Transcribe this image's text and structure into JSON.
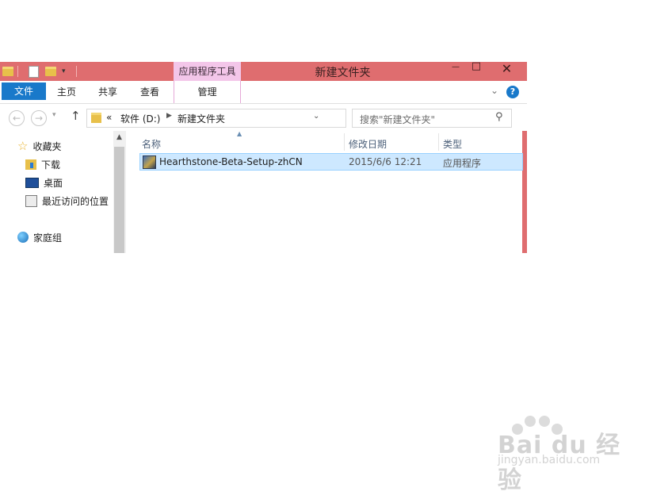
{
  "window": {
    "title": "新建文件夹",
    "contextual_tab_header": "应用程序工具",
    "close_glyph": "✕",
    "minimize_glyph": "—",
    "maximize_glyph": "□"
  },
  "ribbon": {
    "tabs": [
      {
        "label": "文件",
        "active": true
      },
      {
        "label": "主页"
      },
      {
        "label": "共享"
      },
      {
        "label": "查看"
      },
      {
        "label": "管理"
      }
    ],
    "help_glyph": "?"
  },
  "address_bar": {
    "overflow": "«",
    "crumbs": [
      "软件 (D:)",
      "新建文件夹"
    ]
  },
  "search": {
    "placeholder": "搜索\"新建文件夹\""
  },
  "nav_pane": {
    "favorites": "收藏夹",
    "items": [
      "下载",
      "桌面",
      "最近访问的位置"
    ],
    "homegroup": "家庭组"
  },
  "columns": [
    "名称",
    "修改日期",
    "类型"
  ],
  "files": [
    {
      "name": "Hearthstone-Beta-Setup-zhCN",
      "modified": "2015/6/6 12:21",
      "type": "应用程序",
      "selected": true
    }
  ],
  "watermark": {
    "brand": "Bai du 经验",
    "url": "jingyan.baidu.com"
  },
  "colors": {
    "titlebar": "#df6d6f",
    "file_tab": "#1979ca",
    "contextual_tab": "#f3c6e9",
    "selection": "#cde8ff"
  }
}
